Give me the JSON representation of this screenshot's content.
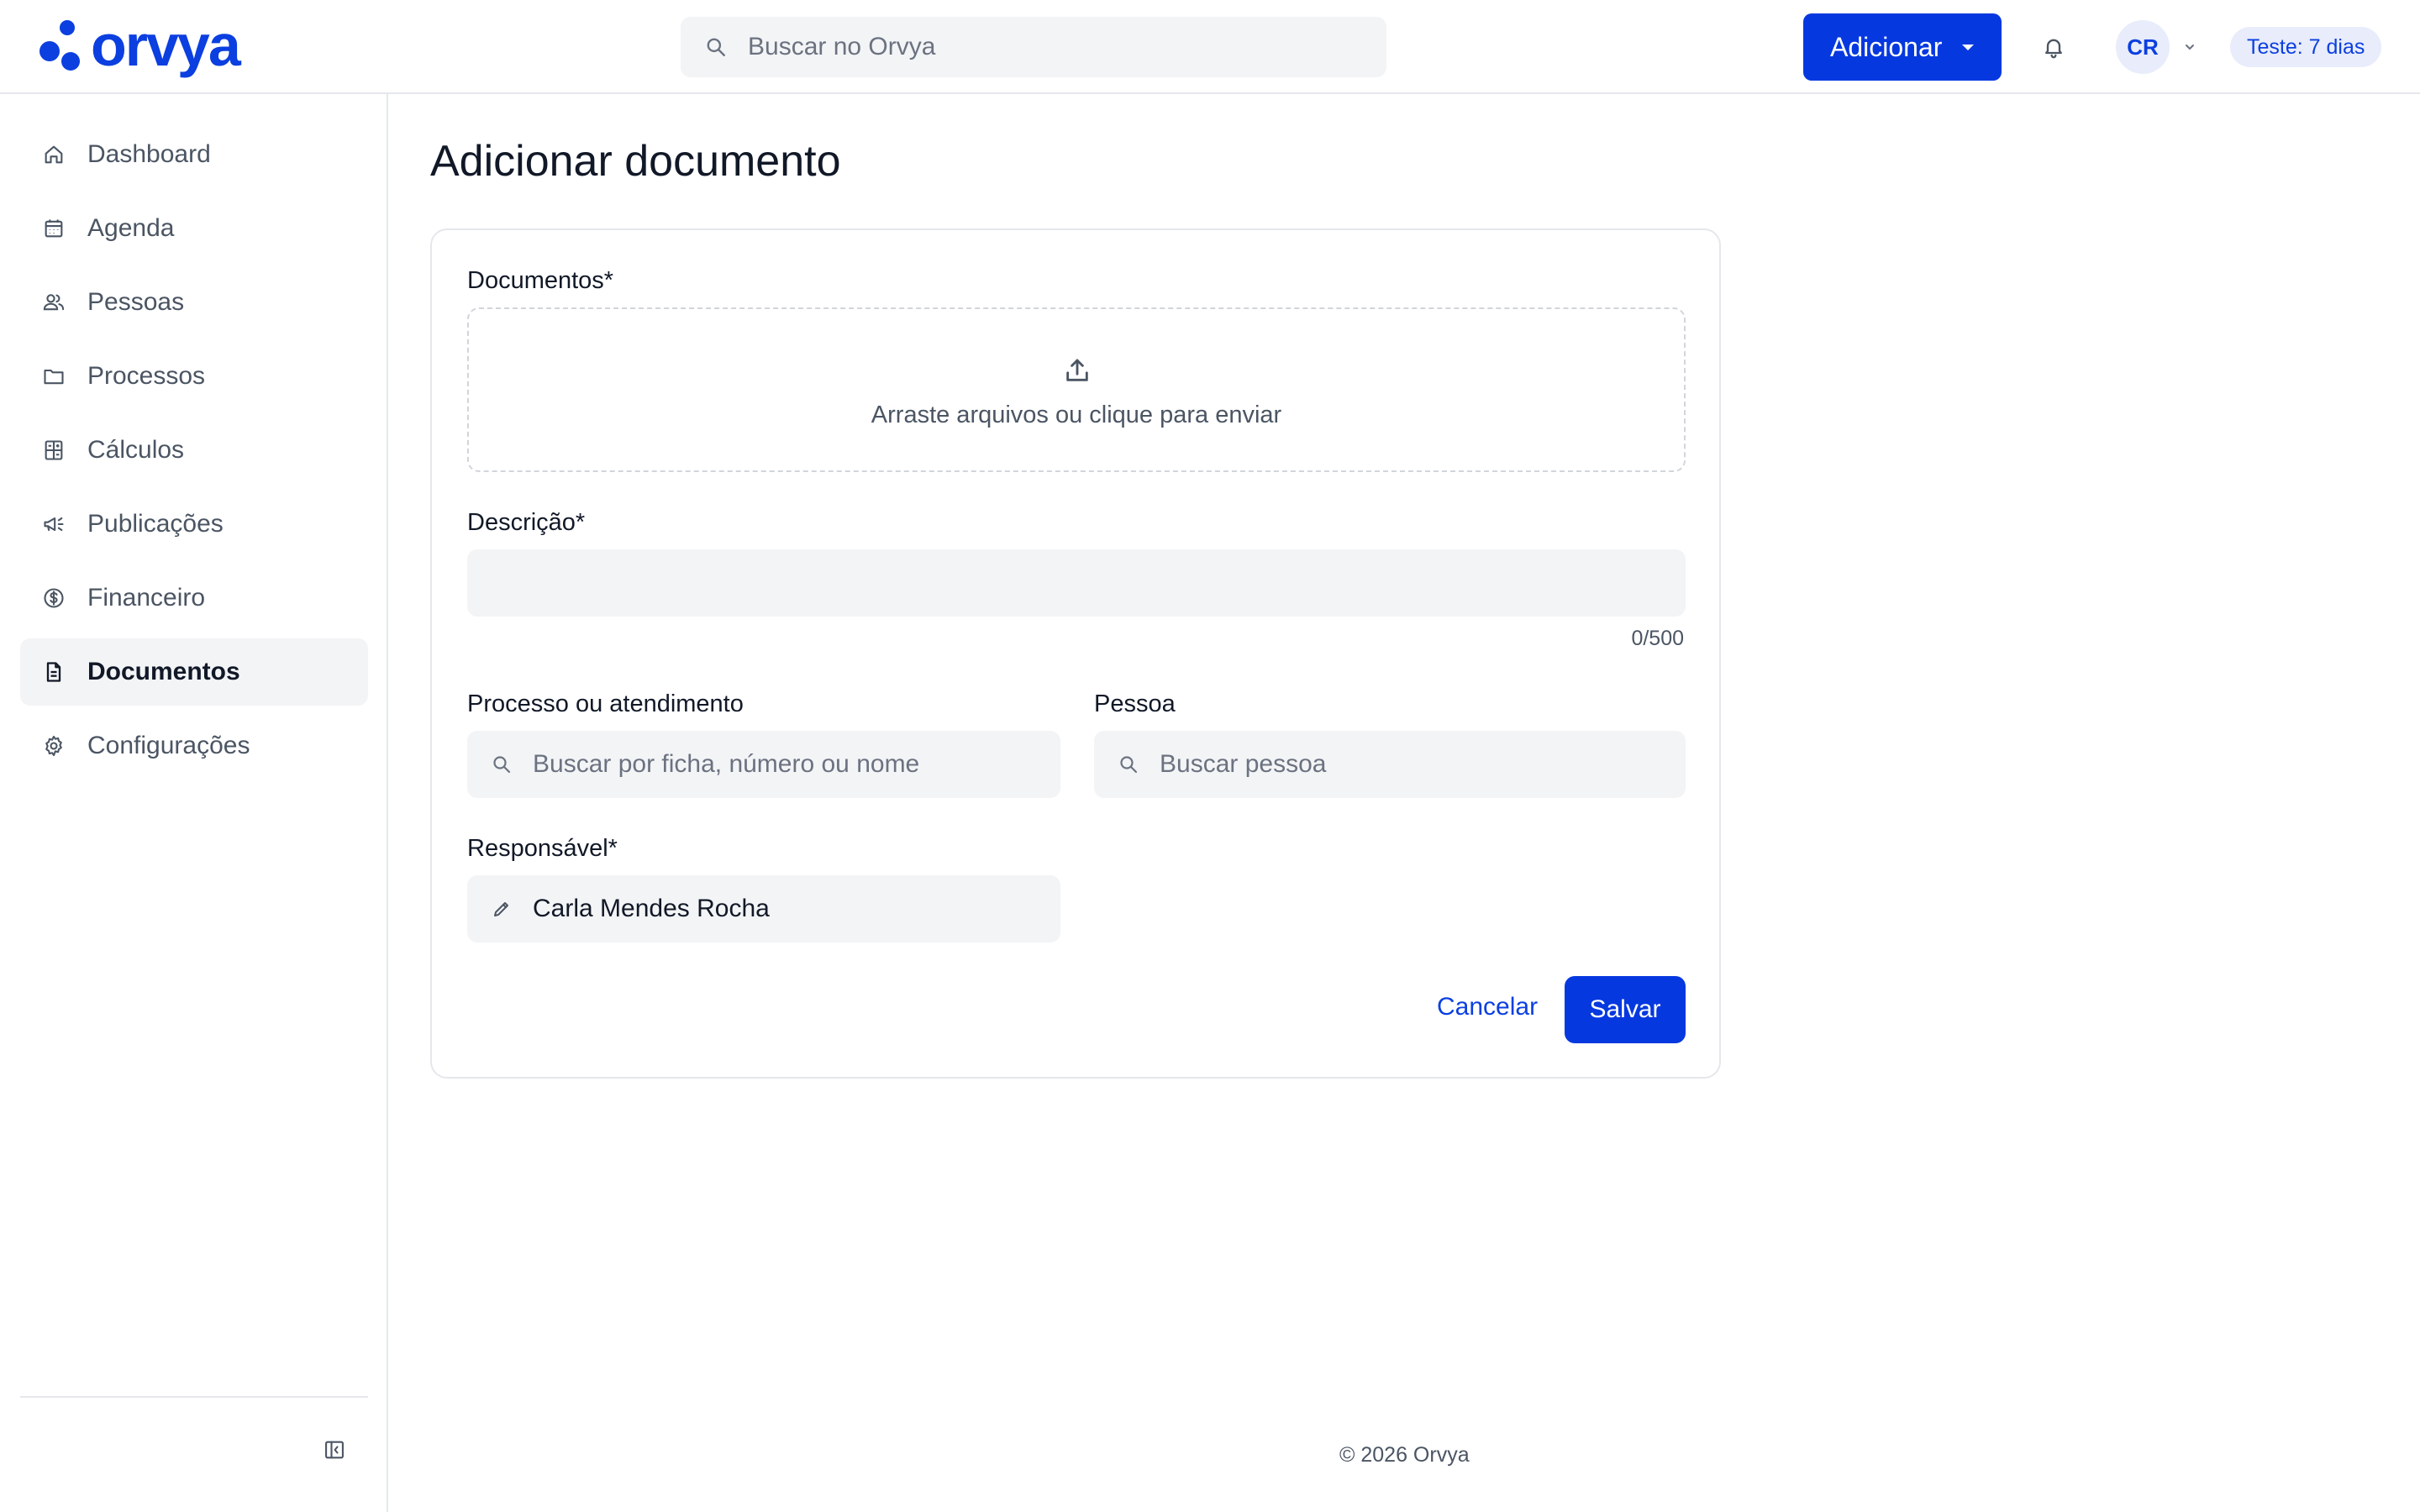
{
  "header": {
    "logo_text": "orvya",
    "search_placeholder": "Buscar no Orvya",
    "add_button": "Adicionar",
    "avatar_initials": "CR",
    "trial_badge": "Teste: 7 dias"
  },
  "sidebar": {
    "items": [
      {
        "label": "Dashboard",
        "icon": "home-icon"
      },
      {
        "label": "Agenda",
        "icon": "calendar-icon"
      },
      {
        "label": "Pessoas",
        "icon": "people-icon"
      },
      {
        "label": "Processos",
        "icon": "folder-icon"
      },
      {
        "label": "Cálculos",
        "icon": "calculator-icon"
      },
      {
        "label": "Publicações",
        "icon": "megaphone-icon"
      },
      {
        "label": "Financeiro",
        "icon": "dollar-icon"
      },
      {
        "label": "Documentos",
        "icon": "document-icon",
        "active": true
      },
      {
        "label": "Configurações",
        "icon": "gear-icon"
      }
    ]
  },
  "main": {
    "title": "Adicionar documento",
    "form": {
      "documents_label": "Documentos*",
      "dropzone_text": "Arraste arquivos ou clique para enviar",
      "description_label": "Descrição*",
      "description_value": "",
      "description_counter": "0/500",
      "process_label": "Processo ou atendimento",
      "process_placeholder": "Buscar por ficha, número ou nome",
      "person_label": "Pessoa",
      "person_placeholder": "Buscar pessoa",
      "responsible_label": "Responsável*",
      "responsible_value": "Carla Mendes Rocha",
      "cancel_button": "Cancelar",
      "save_button": "Salvar"
    }
  },
  "footer": {
    "copyright": "© 2026 Orvya"
  },
  "colors": {
    "brand": "#0638e0",
    "brand_text": "#0b3fe0",
    "field_bg": "#f3f4f6",
    "border": "#e5e7eb"
  }
}
